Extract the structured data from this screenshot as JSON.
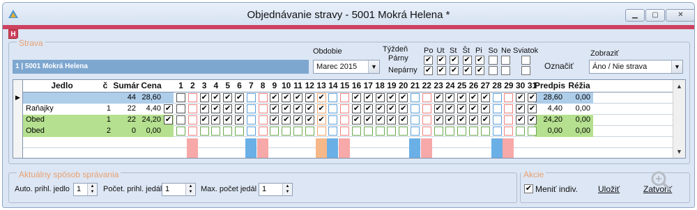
{
  "window": {
    "title": "Objednávanie stravy - 5001 Mokrá Helena *",
    "badge": "H"
  },
  "strava": {
    "legend": "Strava",
    "person": "1 | 5001 Mokrá Helena",
    "obdobie_label": "Obdobie",
    "obdobie_value": "Marec 2015",
    "tyzden_label": "Týždeň",
    "parny_label": "Párny",
    "neparny_label": "Nepárny",
    "days": [
      "Po",
      "Ut",
      "St",
      "Št",
      "Pi",
      "So",
      "Ne"
    ],
    "parny_checks": [
      true,
      true,
      true,
      true,
      true,
      false,
      false
    ],
    "neparny_checks": [
      true,
      true,
      true,
      true,
      true,
      false,
      false
    ],
    "sviatok_label": "Sviatok",
    "oznacit_label": "Označiť",
    "zobrazit_label": "Zobraziť",
    "zobrazit_value": "Áno / Nie strava"
  },
  "grid": {
    "headers": {
      "jedlo": "Jedlo",
      "c": "č",
      "sumar": "Sumár",
      "cena": "Cena",
      "predpis": "Predpis",
      "rezia": "Réžia"
    },
    "day_numbers": [
      "1",
      "2",
      "3",
      "4",
      "5",
      "6",
      "7",
      "8",
      "9",
      "10",
      "11",
      "12",
      "13",
      "14",
      "15",
      "16",
      "17",
      "18",
      "19",
      "20",
      "21",
      "22",
      "23",
      "24",
      "25",
      "26",
      "27",
      "28",
      "29",
      "30",
      "31"
    ],
    "day_types": [
      "w",
      "r",
      "w",
      "w",
      "w",
      "w",
      "b",
      "r",
      "w",
      "w",
      "w",
      "w",
      "o",
      "b",
      "r",
      "w",
      "w",
      "w",
      "w",
      "w",
      "b",
      "r",
      "w",
      "w",
      "w",
      "w",
      "w",
      "b",
      "r",
      "w",
      "w"
    ],
    "rows": [
      {
        "jedlo": "",
        "c": "",
        "sumar": "44",
        "cena": "28,60",
        "predpis": "28,60",
        "rezia": "0,00",
        "color": "#aecde9",
        "allcheck": false,
        "checks": [
          false,
          false,
          true,
          true,
          true,
          true,
          false,
          false,
          true,
          true,
          true,
          true,
          true,
          false,
          false,
          true,
          true,
          true,
          true,
          true,
          false,
          false,
          true,
          true,
          true,
          true,
          true,
          false,
          false,
          true,
          true
        ]
      },
      {
        "jedlo": "Raňajky",
        "c": "1",
        "sumar": "22",
        "cena": "4,40",
        "predpis": "4,40",
        "rezia": "0,00",
        "color": "#ffffff",
        "allcheck": true,
        "checks": [
          false,
          false,
          true,
          true,
          true,
          true,
          false,
          false,
          true,
          true,
          true,
          true,
          true,
          false,
          false,
          true,
          true,
          true,
          true,
          true,
          false,
          false,
          true,
          true,
          true,
          true,
          true,
          false,
          false,
          true,
          true
        ]
      },
      {
        "jedlo": "Obed",
        "c": "1",
        "sumar": "22",
        "cena": "24,20",
        "predpis": "24,20",
        "rezia": "0,00",
        "color": "#b5e08f",
        "allcheck": true,
        "checks": [
          false,
          false,
          true,
          true,
          true,
          true,
          false,
          false,
          true,
          true,
          true,
          true,
          true,
          false,
          false,
          true,
          true,
          true,
          true,
          true,
          false,
          false,
          true,
          true,
          true,
          true,
          true,
          false,
          false,
          true,
          true
        ]
      },
      {
        "jedlo": "Obed",
        "c": "2",
        "sumar": "0",
        "cena": "0,00",
        "predpis": "0,00",
        "rezia": "0,00",
        "color": "#b5e08f",
        "allcheck": false,
        "checks": [
          false,
          false,
          false,
          false,
          false,
          false,
          false,
          false,
          false,
          false,
          false,
          false,
          false,
          false,
          false,
          false,
          false,
          false,
          false,
          false,
          false,
          false,
          false,
          false,
          false,
          false,
          false,
          false,
          false,
          false,
          false
        ]
      }
    ]
  },
  "sposob": {
    "legend": "Aktuálny spôsob správania",
    "auto_label": "Auto. prihl. jedlo",
    "auto_value": "1",
    "pocet_label": "Počet. prihl. jedál",
    "pocet_value": "1",
    "max_label": "Max. počet jedál",
    "max_value": "1"
  },
  "akcie": {
    "legend": "Akcie",
    "menit_label": "Meniť indiv.",
    "menit_checked": true,
    "ulozit_label": "Uložiť",
    "zatvorit_label": "Zatvoriť"
  },
  "colors": {
    "blue": "#5aa0dc",
    "red": "#f08080",
    "orange": "#f2a56a",
    "blue_fill": "#6ab0e6",
    "red_fill": "#f7a8a8",
    "orange_fill": "#f6b888"
  }
}
